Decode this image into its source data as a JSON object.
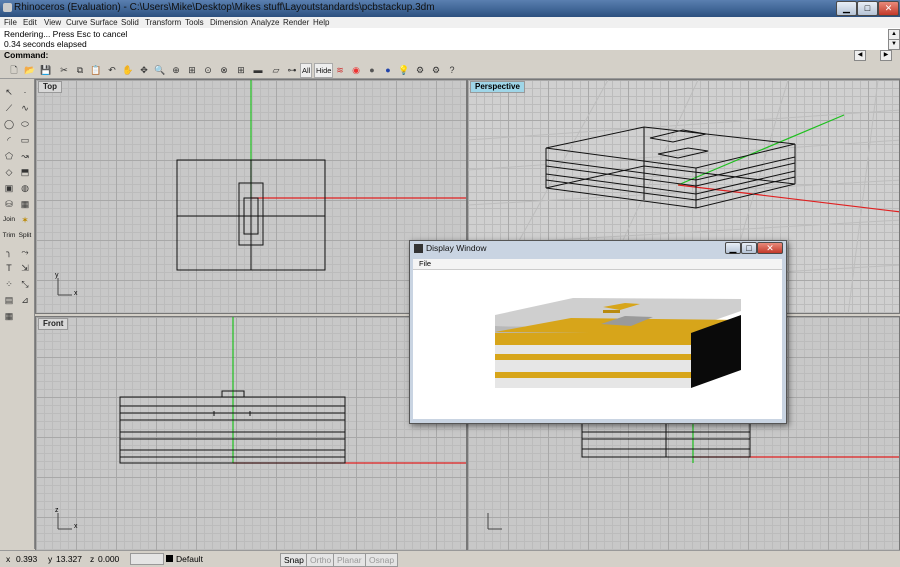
{
  "window": {
    "title": "Rhinoceros (Evaluation) - C:\\Users\\Mike\\Desktop\\Mikes stuff\\Layoutstandards\\pcbstackup.3dm",
    "minimize_label": "▁",
    "maximize_label": "□",
    "close_label": "✕"
  },
  "menu": [
    "File",
    "Edit",
    "View",
    "Curve",
    "Surface",
    "Solid",
    "Transform",
    "Tools",
    "Dimension",
    "Analyze",
    "Render",
    "Help"
  ],
  "command": {
    "history": [
      "Rendering... Press Esc to cancel",
      "0.34 seconds elapsed"
    ],
    "prompt": "Command:"
  },
  "toolbar": {
    "all_label": "All",
    "hide_label": "Hide"
  },
  "left_toolbar": {
    "join_label": "Join",
    "trim_label": "Trim",
    "split_label": "Split"
  },
  "viewports": {
    "top": "Top",
    "perspective": "Perspective",
    "front": "Front",
    "axis_x": "x",
    "axis_y": "y",
    "axis_z": "z"
  },
  "display_window": {
    "title": "Display Window",
    "menu_file": "File"
  },
  "status": {
    "x_label": "x",
    "x_value": "0.393",
    "y_label": "y",
    "y_value": "13.327",
    "z_label": "z",
    "z_value": "0.000",
    "layer": "Default",
    "snap": "Snap",
    "ortho": "Ortho",
    "planar": "Planar",
    "osnap": "Osnap"
  },
  "colors": {
    "copper": "#d7a51a",
    "x_axis": "#e02020",
    "y_axis": "#1ec01e",
    "active_viewport": "#9fd6e8"
  }
}
